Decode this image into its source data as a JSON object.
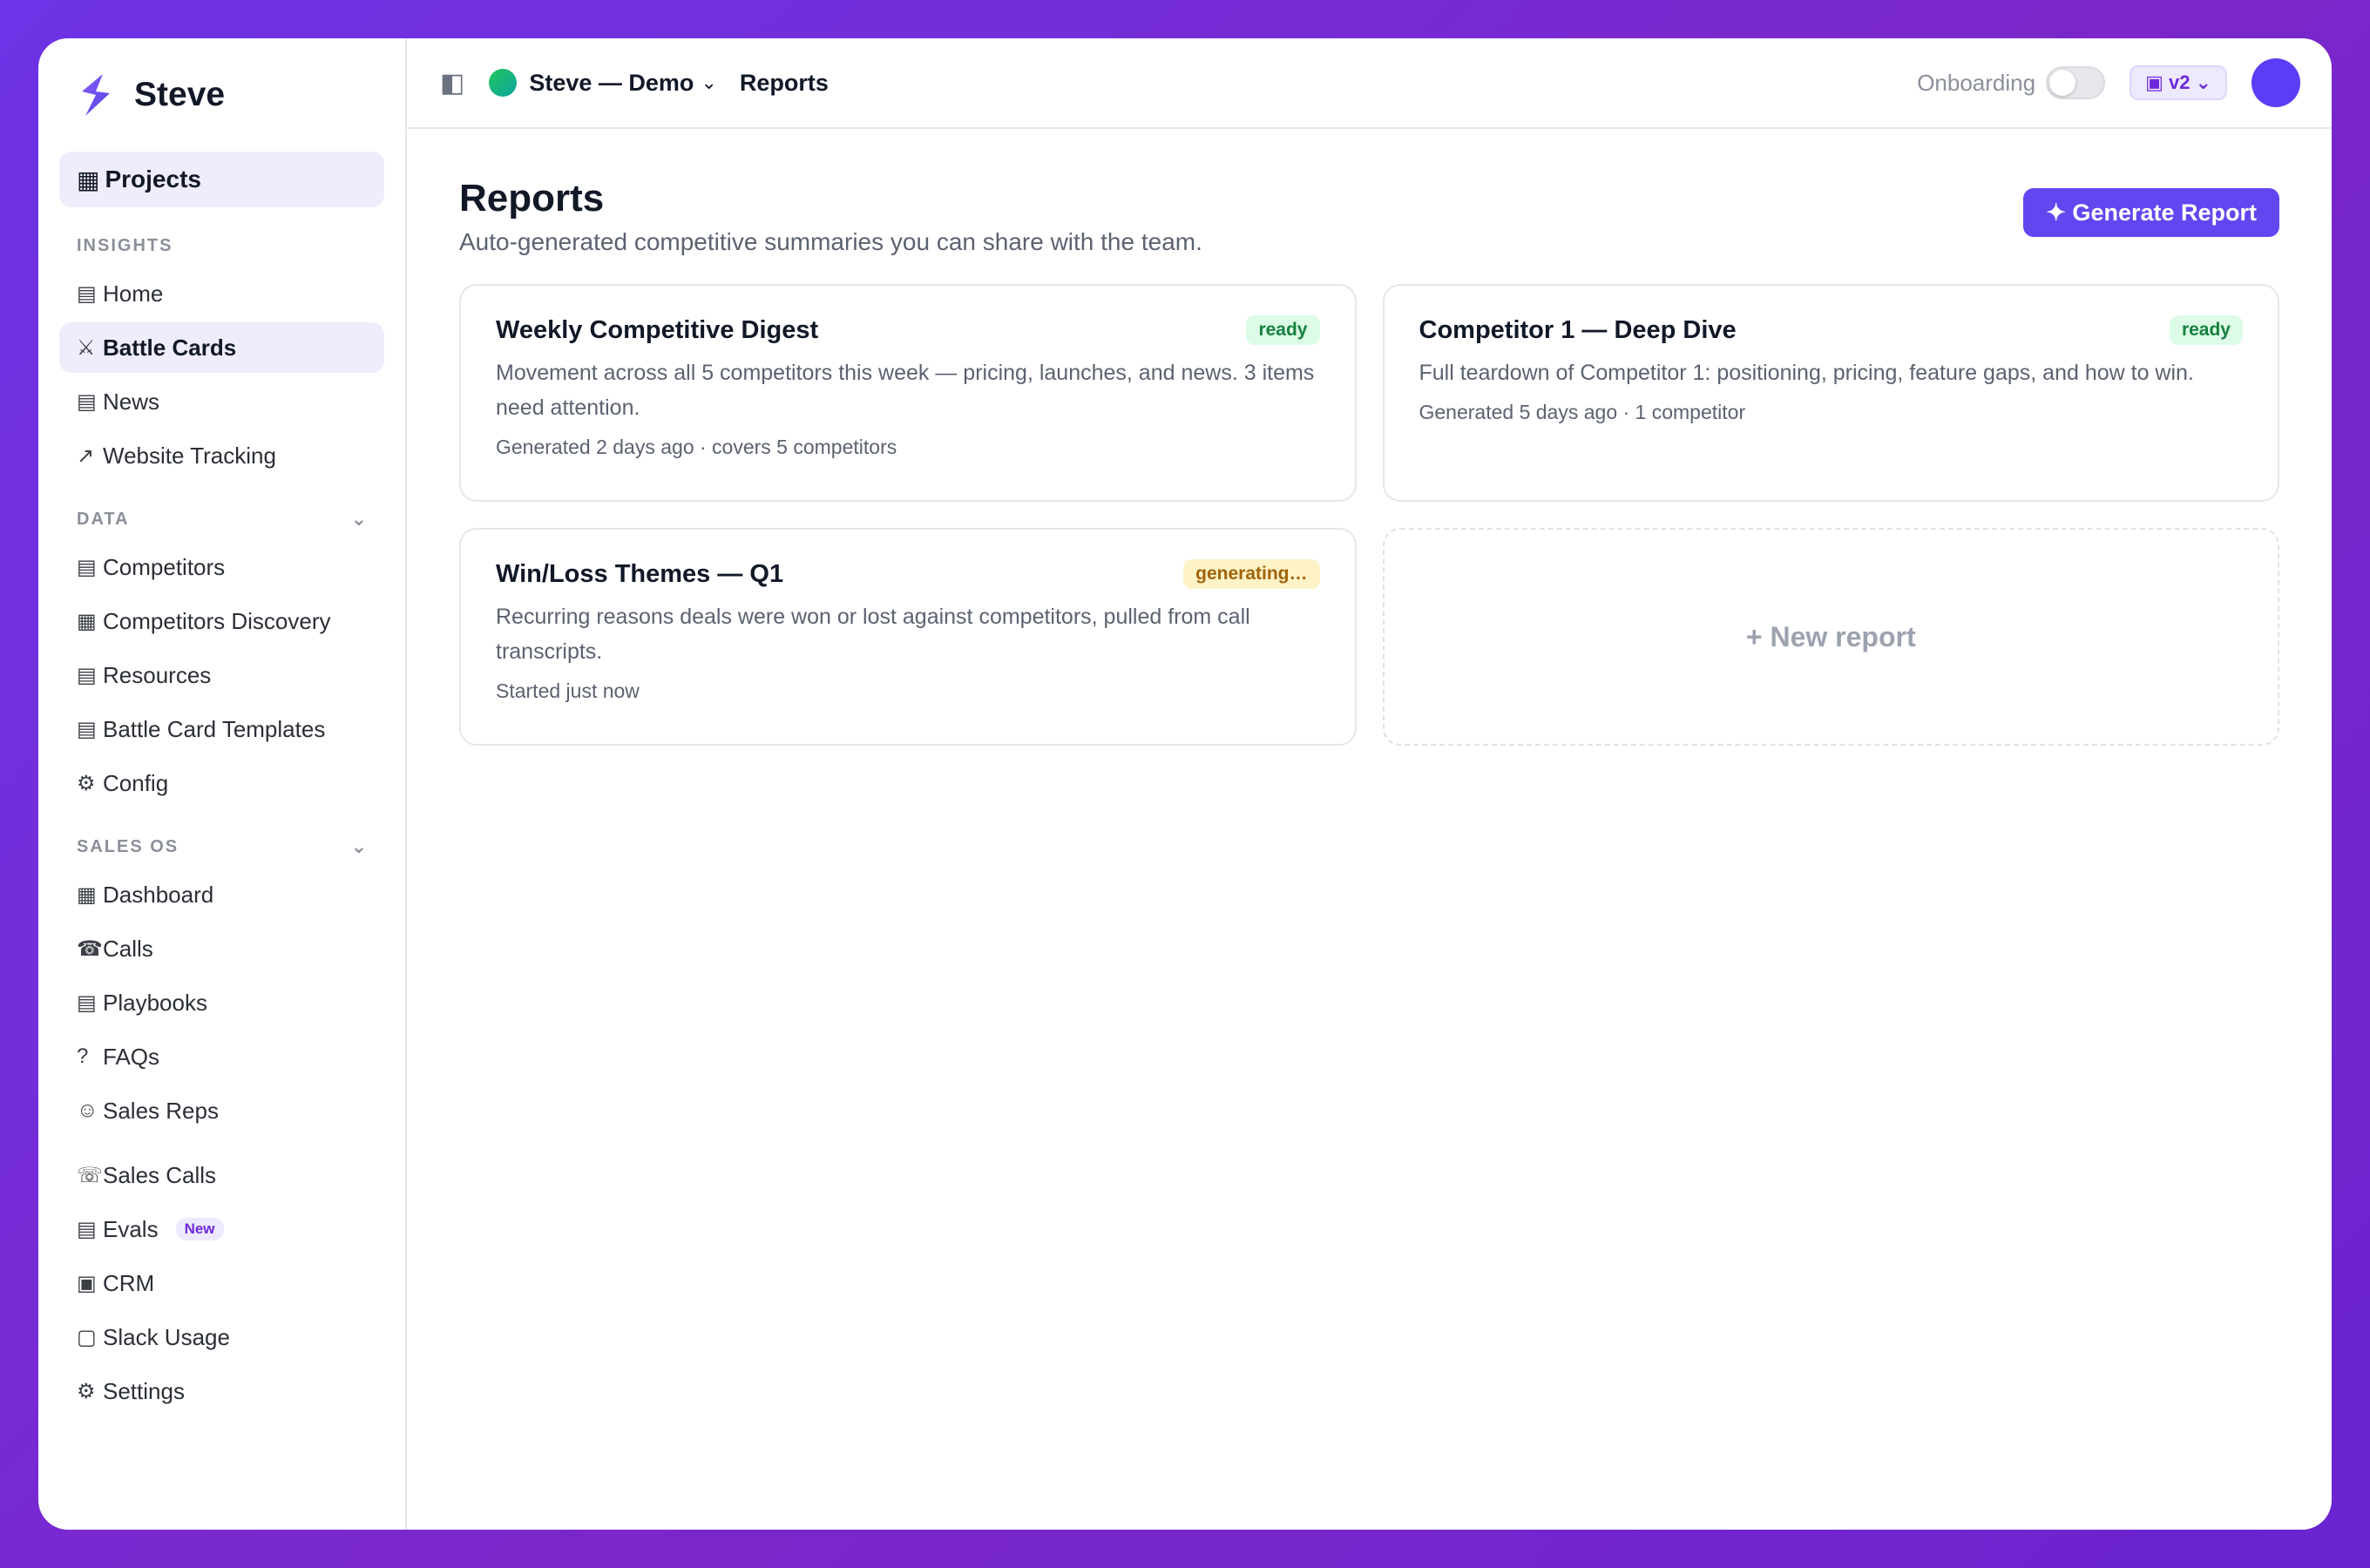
{
  "brand": {
    "name": "Steve"
  },
  "sidebar": {
    "projects": {
      "icon": "▦",
      "label": "Projects"
    },
    "insights_heading": "INSIGHTS",
    "insights": [
      {
        "icon": "▤",
        "label": "Home"
      },
      {
        "icon": "⚔",
        "label": "Battle Cards",
        "active": true
      },
      {
        "icon": "▤",
        "label": "News"
      },
      {
        "icon": "↗",
        "label": "Website Tracking"
      }
    ],
    "data_heading": "DATA",
    "data_chevron": "⌄",
    "data": [
      {
        "icon": "▤",
        "label": "Competitors"
      },
      {
        "icon": "▦",
        "label": "Competitors Discovery"
      },
      {
        "icon": "▤",
        "label": "Resources"
      },
      {
        "icon": "▤",
        "label": "Battle Card Templates"
      },
      {
        "icon": "⚙",
        "label": "Config"
      }
    ],
    "sales_heading": "SALES OS",
    "sales_chevron": "⌄",
    "sales": [
      {
        "icon": "▦",
        "label": "Dashboard"
      },
      {
        "icon": "☎",
        "label": "Calls"
      },
      {
        "icon": "▤",
        "label": "Playbooks"
      },
      {
        "icon": "?",
        "label": "FAQs"
      },
      {
        "icon": "☺",
        "label": "Sales Reps"
      }
    ],
    "extra": [
      {
        "icon": "☏",
        "label": "Sales Calls"
      },
      {
        "icon": "▤",
        "label": "Evals",
        "badge": "New"
      },
      {
        "icon": "▣",
        "label": "CRM"
      },
      {
        "icon": "▢",
        "label": "Slack Usage"
      },
      {
        "icon": "⚙",
        "label": "Settings"
      }
    ]
  },
  "topbar": {
    "panel_icon": "◧",
    "workspace": "Steve — Demo",
    "workspace_chevron": "⌄",
    "breadcrumb": "Reports",
    "onboarding_label": "Onboarding",
    "onboarding_on": false,
    "version": "▣ v2 ⌄"
  },
  "page": {
    "title": "Reports",
    "subtitle": "Auto-generated competitive summaries you can share with the team.",
    "generate_button": "✦ Generate Report"
  },
  "reports": [
    {
      "title": "Weekly Competitive Digest",
      "status": "ready",
      "description": "Movement across all 5 competitors this week — pricing, launches, and news. 3 items need attention.",
      "meta": "Generated 2 days ago · covers 5 competitors"
    },
    {
      "title": "Competitor 1 — Deep Dive",
      "status": "ready",
      "description": "Full teardown of Competitor 1: positioning, pricing, feature gaps, and how to win.",
      "meta": "Generated 5 days ago · 1 competitor"
    },
    {
      "title": "Win/Loss Themes — Q1",
      "status": "generating…",
      "description": "Recurring reasons deals were won or lost against competitors, pulled from call transcripts.",
      "meta": "Started just now"
    }
  ],
  "new_report_label": "+ New report",
  "colors": {
    "accent": "#6346f0",
    "ready": "#15803d",
    "generating": "#a16207"
  }
}
